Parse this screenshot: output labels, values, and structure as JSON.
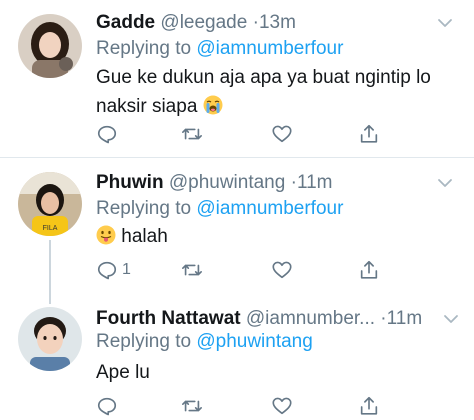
{
  "tweets": [
    {
      "name": "Gadde",
      "handle": "@leegade",
      "dot": "·",
      "time": "13m",
      "replying_prefix": "Replying to",
      "replying_to": "@iamnumberfour",
      "text_line1": "Gue ke dukun aja apa ya buat ngintip lo",
      "text_line2": "naksir siapa",
      "emoji": "loudly-crying-face",
      "reply_count": "",
      "avatar_colors": [
        "#d9cfc4",
        "#2b1d14",
        "#f1d3c0"
      ]
    },
    {
      "name": "Phuwin",
      "handle": "@phuwintang",
      "dot": "·",
      "time": "11m",
      "replying_prefix": "Replying to",
      "replying_to": "@iamnumberfour",
      "text": "halah",
      "emoji": "face-with-tongue",
      "reply_count": "1",
      "avatar_colors": [
        "#c9b79a",
        "#1b1510",
        "#f5c518"
      ]
    },
    {
      "name": "Fourth Nattawat",
      "handle": "@iamnumber...",
      "dot": "·",
      "time": "11m",
      "replying_prefix": "Replying to",
      "replying_to": "@phuwintang",
      "text": "Ape lu",
      "reply_count": "",
      "avatar_colors": [
        "#dfe6e9",
        "#231a14",
        "#f3d2bd"
      ]
    }
  ],
  "colors": {
    "secondary_text": "#657786",
    "link": "#1da1f2",
    "divider": "#e1e8ed",
    "thread_line": "#ccd6dd"
  }
}
